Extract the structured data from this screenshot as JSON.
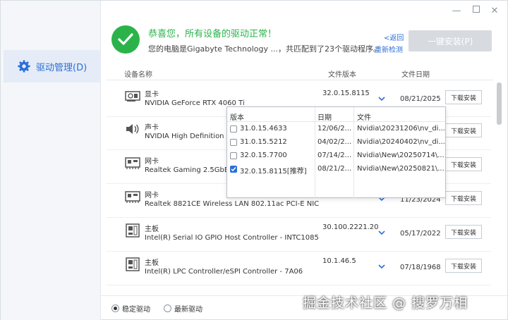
{
  "window_controls": {
    "minimize": "—",
    "close": "✕"
  },
  "sidebar": {
    "items": [
      {
        "label": "驱动管理(D)",
        "icon": "gear-icon"
      }
    ]
  },
  "header": {
    "title": "恭喜您，所有设备的驱动正常！",
    "subtitle": "您的电脑是Gigabyte Technology ...，共匹配到了23个驱动程序。",
    "back_link": "<返回",
    "recheck_link": "重新检测",
    "one_key_button": "一键安装(P)"
  },
  "columns": {
    "device": "设备名称",
    "version": "文件版本",
    "date": "文件日期"
  },
  "rows": [
    {
      "category": "显卡",
      "device": "NVIDIA GeForce RTX 4060 Ti",
      "version": "32.0.15.8115",
      "date": "08/21/2025",
      "button": "下载安装",
      "icon": "gpu-icon"
    },
    {
      "category": "声卡",
      "device": "NVIDIA High Definition Au",
      "version": "",
      "date": "",
      "button": "下载安装",
      "icon": "speaker-icon"
    },
    {
      "category": "网卡",
      "device": "Realtek Gaming 2.5GbE F",
      "version": "",
      "date": "",
      "button": "下载安装",
      "icon": "network-card-icon"
    },
    {
      "category": "网卡",
      "device": "Realtek 8821CE Wireless LAN 802.11ac PCI-E NIC",
      "version": "",
      "date": "11/23/2024",
      "button": "下载安装",
      "icon": "network-card-icon"
    },
    {
      "category": "主板",
      "device": "Intel(R) Serial IO GPIO Host Controller - INTC1085",
      "version": "30.100.2221.20",
      "date": "05/17/2022",
      "button": "下载安装",
      "icon": "motherboard-icon"
    },
    {
      "category": "主板",
      "device": "Intel(R) LPC Controller/eSPI Controller - 7A06",
      "version": "10.1.46.5",
      "date": "07/18/1968",
      "button": "下载安装",
      "icon": "motherboard-icon"
    }
  ],
  "version_dropdown": {
    "headers": {
      "version": "版本",
      "date": "日期",
      "file": "文件"
    },
    "options": [
      {
        "version": "31.0.15.4633",
        "date": "12/06/2...",
        "file": "Nvidia\\20231206\\nv_di...",
        "checked": false
      },
      {
        "version": "31.0.15.5212",
        "date": "04/02/2...",
        "file": "Nvidia\\20240402\\nv_di...",
        "checked": false
      },
      {
        "version": "32.0.15.7700",
        "date": "07/14/2...",
        "file": "Nvidia\\New\\20250714\\...",
        "checked": false
      },
      {
        "version": "32.0.15.8115[推荐]",
        "date": "08/21/2...",
        "file": "Nvidia\\New\\20250821\\...",
        "checked": true
      }
    ]
  },
  "footer": {
    "stable_label": "稳定驱动",
    "latest_label": "最新驱动",
    "selected": "stable"
  },
  "watermark": "掘金技术社区 @ 搜罗万相",
  "colors": {
    "accent": "#2b6fd6",
    "success": "#2bb34a",
    "disabled": "#d7dadf"
  }
}
